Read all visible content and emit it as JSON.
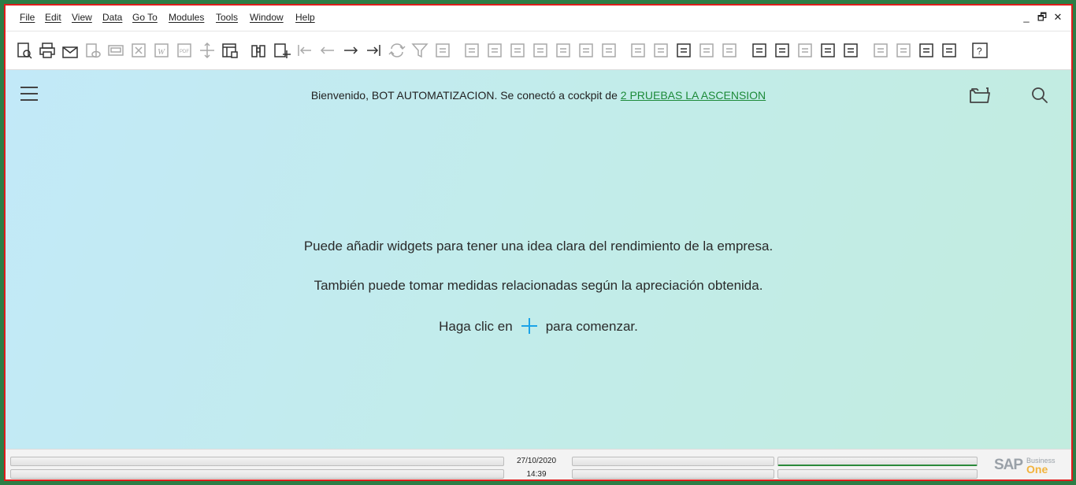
{
  "menu": [
    "File",
    "Edit",
    "View",
    "Data",
    "Go To",
    "Modules",
    "Tools",
    "Window",
    "Help"
  ],
  "window_controls": {
    "minimize": "_",
    "restore": "🗗",
    "close": "✕"
  },
  "toolbar_icons": [
    "preview-icon",
    "print-icon",
    "email-icon",
    "sms-icon",
    "fax-icon",
    "excel-icon",
    "word-icon",
    "pdf-icon",
    "move-icon",
    "form-settings-icon",
    "find-icon",
    "add-icon",
    "first-record-icon",
    "previous-record-icon",
    "next-record-icon",
    "last-record-icon",
    "refresh-icon",
    "filter-icon",
    "sort-icon",
    "base-document-icon",
    "target-document-icon",
    "gross-profit-icon",
    "payment-means-icon",
    "volume-weight-icon",
    "balance-icon",
    "transaction-journal-icon",
    "edit-icon",
    "settings-icon",
    "layout-designer-icon",
    "messages-icon",
    "alerts-icon",
    "approval-icon",
    "inbox-icon",
    "calendar-icon",
    "org-chart-icon",
    "user-icon",
    "dashboard-icon",
    "widgets-icon",
    "chart-icon",
    "report-icon",
    "help-icon"
  ],
  "cockpit": {
    "welcome_prefix": "Bienvenido, BOT AUTOMATIZACION. Se conectó a cockpit de ",
    "company_link": "2 PRUEBAS LA ASCENSION",
    "message1": "Puede añadir widgets para tener una idea clara del rendimiento de la empresa.",
    "message2": "También puede tomar medidas relacionadas según la apreciación obtenida.",
    "message3_prefix": "Haga clic en",
    "message3_suffix": "para comenzar."
  },
  "status": {
    "date": "27/10/2020",
    "time": "14:39"
  },
  "logo": {
    "brand": "SAP",
    "business": "Business",
    "one": "One"
  },
  "colors": {
    "accent": "#1c8a39",
    "plus": "#1aa3e8",
    "border": "#e01b1b"
  }
}
